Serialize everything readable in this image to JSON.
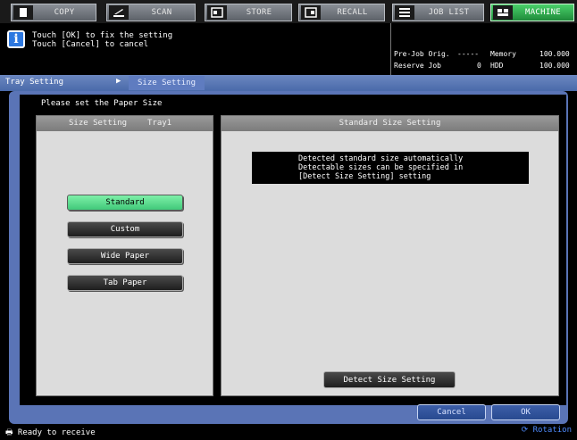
{
  "tabs": [
    {
      "label": "COPY",
      "icon": "copy-icon"
    },
    {
      "label": "SCAN",
      "icon": "scan-icon"
    },
    {
      "label": "STORE",
      "icon": "store-icon"
    },
    {
      "label": "RECALL",
      "icon": "recall-icon"
    },
    {
      "label": "JOB LIST",
      "icon": "job-list-icon"
    },
    {
      "label": "MACHINE",
      "icon": "machine-icon",
      "active": true
    }
  ],
  "message": {
    "line1": "Touch [OK] to fix the setting",
    "line2": "Touch [Cancel] to cancel"
  },
  "status": {
    "pre_job_label": "Pre-Job Orig.",
    "pre_job_value": "-----",
    "reserve_job_label": "Reserve Job",
    "reserve_job_value": "0",
    "memory_label": "Memory",
    "memory_value": "100.000",
    "hdd_label": "HDD",
    "hdd_value": "100.000"
  },
  "breadcrumb": {
    "level1": "Tray Setting",
    "level2": "Size Setting"
  },
  "prompt": "Please set the Paper Size",
  "left_panel": {
    "title": "Size Setting",
    "tray": "Tray1",
    "buttons": [
      {
        "label": "Standard",
        "selected": true
      },
      {
        "label": "Custom",
        "selected": false
      },
      {
        "label": "Wide Paper",
        "selected": false
      },
      {
        "label": "Tab Paper",
        "selected": false
      }
    ]
  },
  "right_panel": {
    "title": "Standard Size Setting",
    "notice_line1": "Detected standard size automatically",
    "notice_line2": "Detectable sizes can be specified in",
    "notice_line3": "[Detect Size Setting] setting",
    "detect_button": "Detect Size Setting"
  },
  "footer": {
    "cancel": "Cancel",
    "ok": "OK"
  },
  "statusbar": {
    "left": "Ready to receive",
    "right": "Rotation"
  },
  "colors": {
    "accent_green": "#41c97a",
    "frame_blue": "#5a74b6",
    "info_blue": "#2d78e0"
  }
}
